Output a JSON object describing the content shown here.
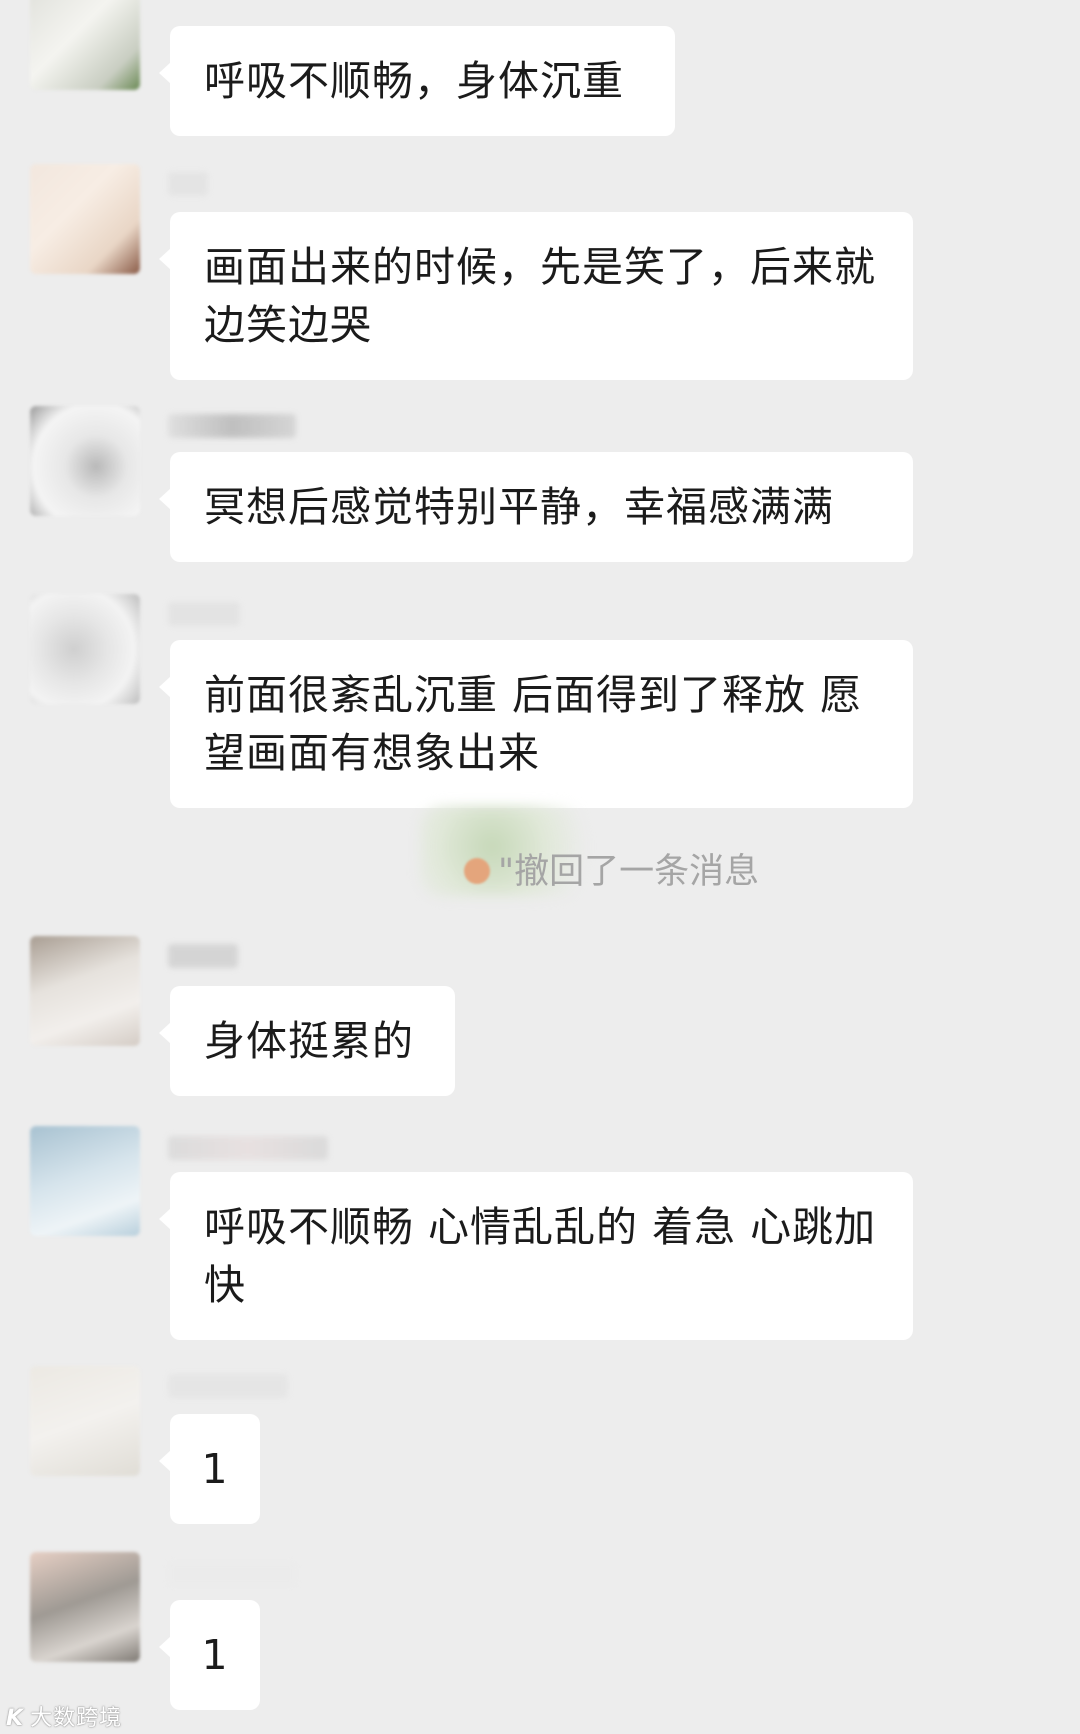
{
  "messages": [
    {
      "text": "呼吸不顺畅，身体沉重"
    },
    {
      "text": "画面出来的时候，先是笑了，后来就边笑边哭"
    },
    {
      "text": "冥想后感觉特别平静，幸福感满满"
    },
    {
      "text": "前面很紊乱沉重 后面得到了释放 愿望画面有想象出来"
    },
    {
      "text": "身体挺累的"
    },
    {
      "text": "呼吸不顺畅 心情乱乱的 着急 心跳加快"
    },
    {
      "text": "1"
    },
    {
      "text": "1"
    }
  ],
  "system_notice": "\"撤回了一条消息",
  "watermark": "大数跨境",
  "watermark_logo": "K"
}
